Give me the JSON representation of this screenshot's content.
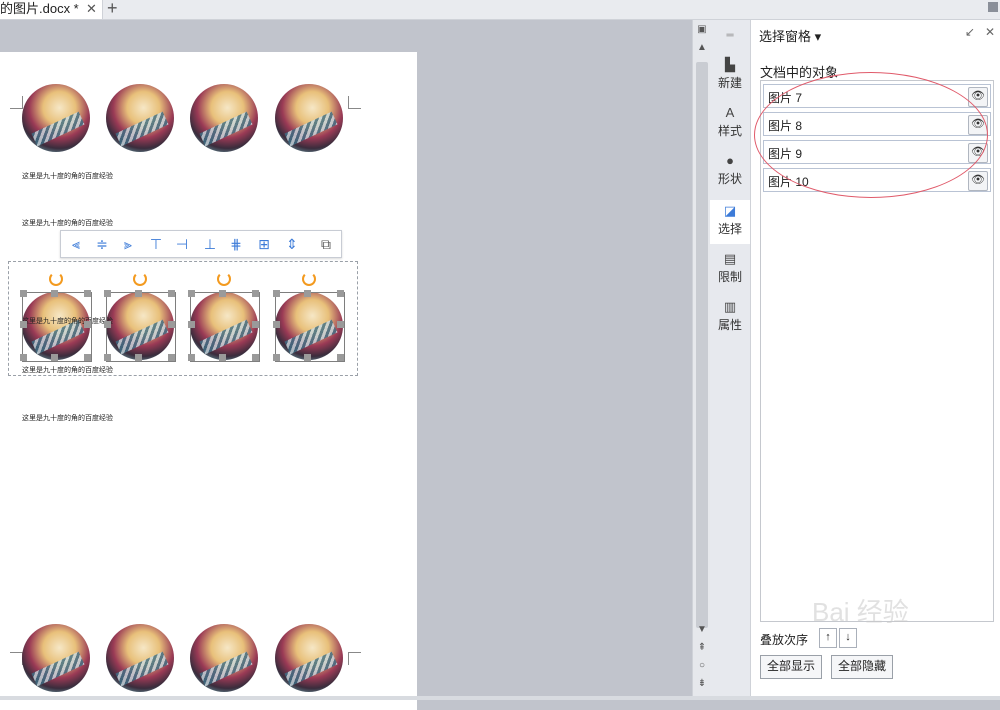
{
  "tabbar": {
    "doc_tab": "的图片.docx *",
    "close_glyph": "✕",
    "new_tab_glyph": "+"
  },
  "document": {
    "caption": "这里是九十度的角的百度经验",
    "toolbar_icons": [
      "align-left-icon",
      "align-center-icon",
      "align-right-icon",
      "align-top-icon",
      "align-middle-icon",
      "align-bottom-icon",
      "distribute-horizontal-icon",
      "distribute-vertical-icon",
      "distribute-spacing-icon",
      "group-icon"
    ]
  },
  "side_tabs": [
    {
      "label": "新建",
      "icon": "new-icon"
    },
    {
      "label": "样式",
      "icon": "style-icon"
    },
    {
      "label": "形状",
      "icon": "shape-icon"
    },
    {
      "label": "选择",
      "icon": "select-icon",
      "active": true
    },
    {
      "label": "限制",
      "icon": "restrict-icon"
    },
    {
      "label": "属性",
      "icon": "properties-icon"
    }
  ],
  "panel": {
    "title": "选择窗格",
    "dropdown_glyph": "▾",
    "objects_label": "文档中的对象",
    "objects": [
      {
        "name": "图片 7"
      },
      {
        "name": "图片 8"
      },
      {
        "name": "图片 9"
      },
      {
        "name": "图片 10"
      }
    ],
    "eye_glyph": "👁",
    "order_label": "叠放次序",
    "show_all": "全部显示",
    "hide_all": "全部隐藏"
  },
  "colors": {
    "accent": "#3c7bd8",
    "annotation": "#e05a6a",
    "rotate_handle": "#f39a1f"
  },
  "watermark": "Bai 经验"
}
